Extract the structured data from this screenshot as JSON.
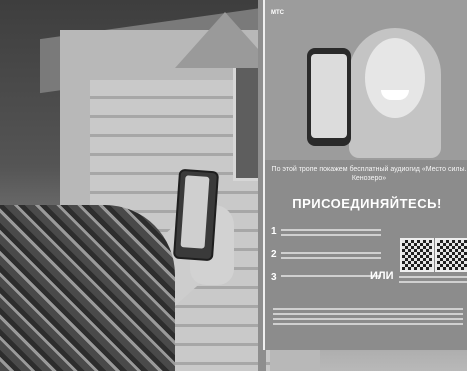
{
  "poster": {
    "brands": [
      "МТС",
      "",
      ""
    ],
    "tagline": "По этой тропе покажем бесплатный аудиогид «Место силы. Кенозеро»",
    "headline": "ПРИСОЕДИНЯЙТЕСЬ!",
    "steps": [
      "1",
      "2",
      "3"
    ],
    "or_label": "ИЛИ"
  }
}
